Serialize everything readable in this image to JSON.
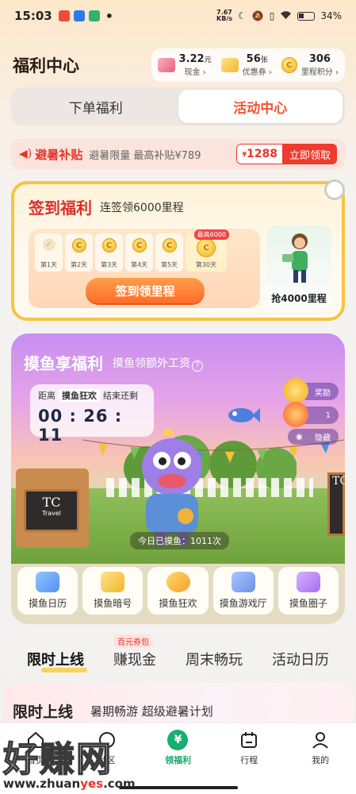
{
  "status": {
    "time": "15:03",
    "netspeed_value": "7.67",
    "netspeed_unit": "KB/s",
    "battery": "34%"
  },
  "header": {
    "title": "福利中心"
  },
  "assets": [
    {
      "value": "3.22",
      "unit": "元",
      "label": "现金 ›"
    },
    {
      "value": "56",
      "unit": "张",
      "label": "优惠券 ›"
    },
    {
      "value": "306",
      "unit": "",
      "label": "里程积分 ›"
    }
  ],
  "tabs": [
    "下单福利",
    "活动中心"
  ],
  "promo": {
    "title": "避暑补贴",
    "sub": "避暑限量 最高补贴¥789",
    "currency": "¥",
    "price": "1288",
    "action": "立即领取"
  },
  "checkin": {
    "title": "签到福利",
    "sub": "连签领6000里程",
    "days": [
      "第1天",
      "第2天",
      "第3天",
      "第4天",
      "第5天",
      "第30天"
    ],
    "max_tag": "最高6000",
    "button": "签到领里程",
    "reward": "抢4000里程"
  },
  "moyu": {
    "title": "摸鱼享福利",
    "sub": "摸鱼领额外工资",
    "cd_prefix": "距离",
    "cd_event": "摸鱼狂欢",
    "cd_suffix": "结束还剩",
    "cd_time": "00 : 26 : 11",
    "side": [
      "奖励",
      "1",
      "隐藏"
    ],
    "stall_sign": "TC",
    "stall_sub": "Travel",
    "right_sign": "TC",
    "fish_count": "今日已摸鱼：1011次",
    "features": [
      "摸鱼日历",
      "摸鱼暗号",
      "摸鱼狂欢",
      "摸鱼游戏厅",
      "摸鱼圈子"
    ]
  },
  "section_tabs": {
    "items": [
      "限时上线",
      "赚现金",
      "周末畅玩",
      "活动日历"
    ],
    "badge": "百元券包"
  },
  "summer": {
    "title": "限时上线",
    "sub": "暑期畅游 超级避暑计划"
  },
  "nav": [
    "首页",
    "社区",
    "领福利",
    "行程",
    "我的"
  ],
  "nav_yuan": "¥",
  "watermark": {
    "text": "好赚网",
    "url_a": "www.zhuan",
    "url_b": "yes",
    "url_c": ".com"
  },
  "colors": {
    "accent": "#f0552e",
    "nav_active": "#16a86b",
    "promo_red": "#e8352c"
  }
}
